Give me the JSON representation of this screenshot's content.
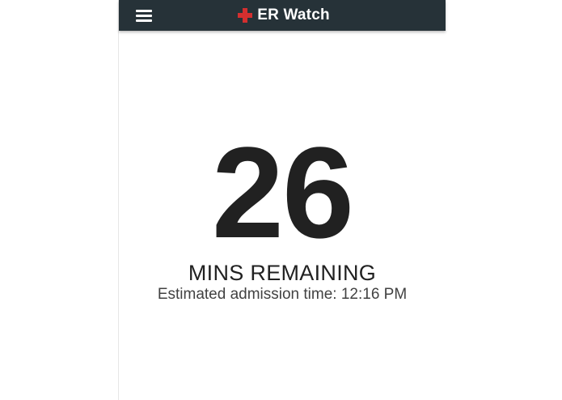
{
  "app": {
    "title": "ER Watch",
    "brand_color": "#d32f2f",
    "appbar_color": "#263238"
  },
  "header": {
    "menu_icon": "hamburger-menu-icon",
    "logo_icon": "red-cross-icon"
  },
  "wait": {
    "minutes": "26",
    "label": "MINS REMAINING",
    "admission_text": "Estimated admission time: 12:16 PM"
  }
}
